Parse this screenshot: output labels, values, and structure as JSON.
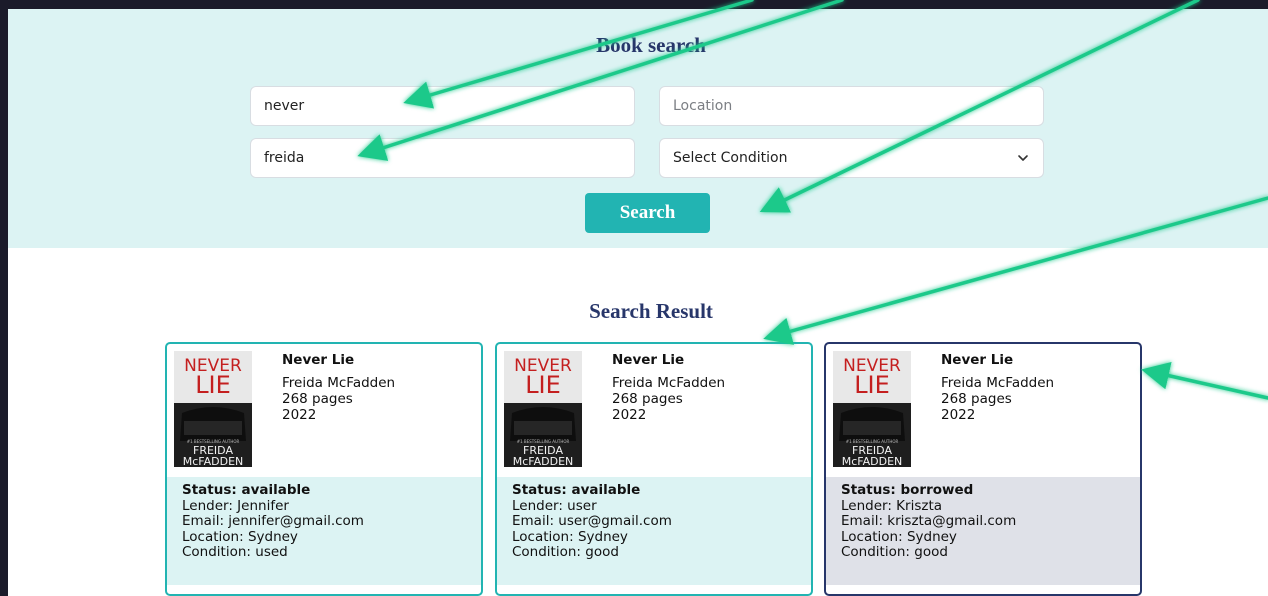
{
  "search": {
    "title": "Book search",
    "title_field_value": "never",
    "author_field_value": "freida",
    "location_placeholder": "Location",
    "condition_select_value": "Select Condition",
    "button_label": "Search"
  },
  "results": {
    "title": "Search Result",
    "cards": [
      {
        "title": "Never Lie",
        "author": "Freida McFadden",
        "pages": "268 pages",
        "year": "2022",
        "status": "Status: available",
        "lender": "Lender: Jennifer",
        "email": "Email: jennifer@gmail.com",
        "location": "Location: Sydney",
        "condition": "Condition: used"
      },
      {
        "title": "Never Lie",
        "author": "Freida McFadden",
        "pages": "268 pages",
        "year": "2022",
        "status": "Status: available",
        "lender": "Lender: user",
        "email": "Email: user@gmail.com",
        "location": "Location: Sydney",
        "condition": "Condition: good"
      },
      {
        "title": "Never Lie",
        "author": "Freida McFadden",
        "pages": "268 pages",
        "year": "2022",
        "status": "Status: borrowed",
        "lender": "Lender: Kriszta",
        "email": "Email: kriszta@gmail.com",
        "location": "Location: Sydney",
        "condition": "Condition: good"
      }
    ]
  },
  "cover": {
    "line1": "NEVER",
    "line2": "LIE",
    "tagline": "#1 BESTSELLING AUTHOR",
    "author_line1": "FREIDA",
    "author_line2": "McFADDEN"
  },
  "colors": {
    "accent": "#22b4b2",
    "heading": "#27366a",
    "panel": "#dcf3f3",
    "borrowed_panel": "#dfe1e8",
    "arrow": "#1fc98a"
  },
  "icons": {
    "condition_select": "chevron-down-icon"
  }
}
